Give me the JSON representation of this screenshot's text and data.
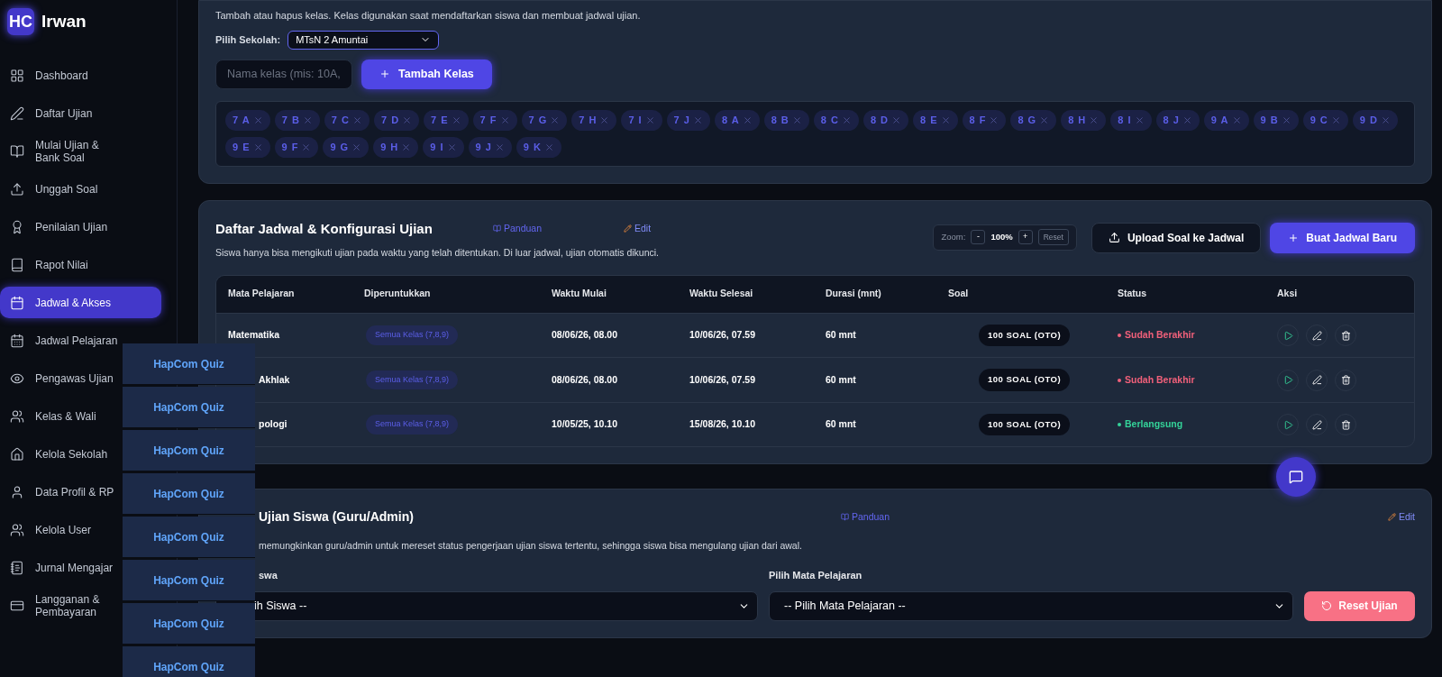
{
  "brand": {
    "logo": "HC",
    "name": "Irwan"
  },
  "sidebar": {
    "items": [
      {
        "label": "Dashboard",
        "selected": false
      },
      {
        "label": "Daftar Ujian",
        "selected": false
      },
      {
        "label": "Mulai Ujian & Bank Soal",
        "selected": false
      },
      {
        "label": "Unggah Soal",
        "selected": false
      },
      {
        "label": "Penilaian Ujian",
        "selected": false
      },
      {
        "label": "Rapot Nilai",
        "selected": false
      },
      {
        "label": "Jadwal & Akses",
        "selected": true
      },
      {
        "label": "Jadwal Pelajaran",
        "selected": false
      },
      {
        "label": "Pengawas Ujian",
        "selected": false
      },
      {
        "label": "Kelas & Wali",
        "selected": false
      },
      {
        "label": "Kelola Sekolah",
        "selected": false
      },
      {
        "label": "Data Profil & RP",
        "selected": false
      },
      {
        "label": "Kelola User",
        "selected": false
      },
      {
        "label": "Jurnal Mengajar",
        "selected": false
      },
      {
        "label": "Langganan & Pembayaran",
        "selected": false
      }
    ]
  },
  "class_card": {
    "description": "Tambah atau hapus kelas. Kelas digunakan saat mendaftarkan siswa dan membuat jadwal ujian.",
    "school_label": "Pilih Sekolah:",
    "school_value": "MTsN 2 Amuntai",
    "class_name_placeholder": "Nama kelas (mis: 10A,",
    "add_button": "Tambah Kelas",
    "classes": [
      "7 A",
      "7 B",
      "7 C",
      "7 D",
      "7 E",
      "7 F",
      "7 G",
      "7 H",
      "7 I",
      "7 J",
      "8 A",
      "8 B",
      "8 C",
      "8 D",
      "8 E",
      "8 F",
      "8 G",
      "8 H",
      "8 I",
      "8 J",
      "9 A",
      "9 B",
      "9 C",
      "9 D",
      "9 E",
      "9 F",
      "9 G",
      "9 H",
      "9 I",
      "9 J",
      "9 K"
    ]
  },
  "schedule_card": {
    "title": "Daftar Jadwal & Konfigurasi Ujian",
    "guide_link": "Panduan",
    "edit_link": "Edit",
    "description": "Siswa hanya bisa mengikuti ujian pada waktu yang telah ditentukan. Di luar jadwal, ujian otomatis dikunci.",
    "zoom": {
      "label": "Zoom:",
      "minus": "-",
      "value": "100%",
      "plus": "+",
      "reset": "Reset"
    },
    "upload_button": "Upload Soal ke Jadwal",
    "new_button": "Buat Jadwal Baru",
    "table": {
      "columns": [
        "Mata Pelajaran",
        "Diperuntukkan",
        "Waktu Mulai",
        "Waktu Selesai",
        "Durasi (mnt)",
        "Soal",
        "Status",
        "Aksi"
      ],
      "rows": [
        {
          "subject": "Matematika",
          "target": "Semua Kelas (7,8,9)",
          "start": "08/06/26, 08.00",
          "end": "10/06/26, 07.59",
          "duration": "60 mnt",
          "questions": "100 SOAL (OTO)",
          "status": "Sudah Berakhir",
          "color": "#f0607a"
        },
        {
          "subject": "Akhlak",
          "target": "Semua Kelas (7,8,9)",
          "start": "08/06/26, 08.00",
          "end": "10/06/26, 07.59",
          "duration": "60 mnt",
          "questions": "100 SOAL (OTO)",
          "status": "Sudah Berakhir",
          "color": "#f0607a"
        },
        {
          "subject": "pologi",
          "target": "Semua Kelas (7,8,9)",
          "start": "10/05/25, 10.10",
          "end": "15/08/26, 10.10",
          "duration": "60 mnt",
          "questions": "100 SOAL (OTO)",
          "status": "Berlangsung",
          "color": "#34d399"
        }
      ]
    }
  },
  "reset_card": {
    "title": "Ujian Siswa (Guru/Admin)",
    "guide_link": "Panduan",
    "edit_link": "Edit",
    "description": "memungkinkan guru/admin untuk mereset status pengerjaan ujian siswa tertentu, sehingga siswa bisa mengulang ujian dari awal.",
    "student_label": "swa",
    "student_value": "ih Siswa --",
    "subject_label": "Pilih Mata Pelajaran",
    "subject_value": "-- Pilih Mata Pelajaran --",
    "reset_button": "Reset Ujian"
  },
  "overlay_tiles": [
    "HapCom Quiz",
    "HapCom Quiz",
    "HapCom Quiz",
    "HapCom Quiz",
    "HapCom Quiz",
    "HapCom Quiz",
    "HapCom Quiz",
    "HapCom Quiz"
  ]
}
